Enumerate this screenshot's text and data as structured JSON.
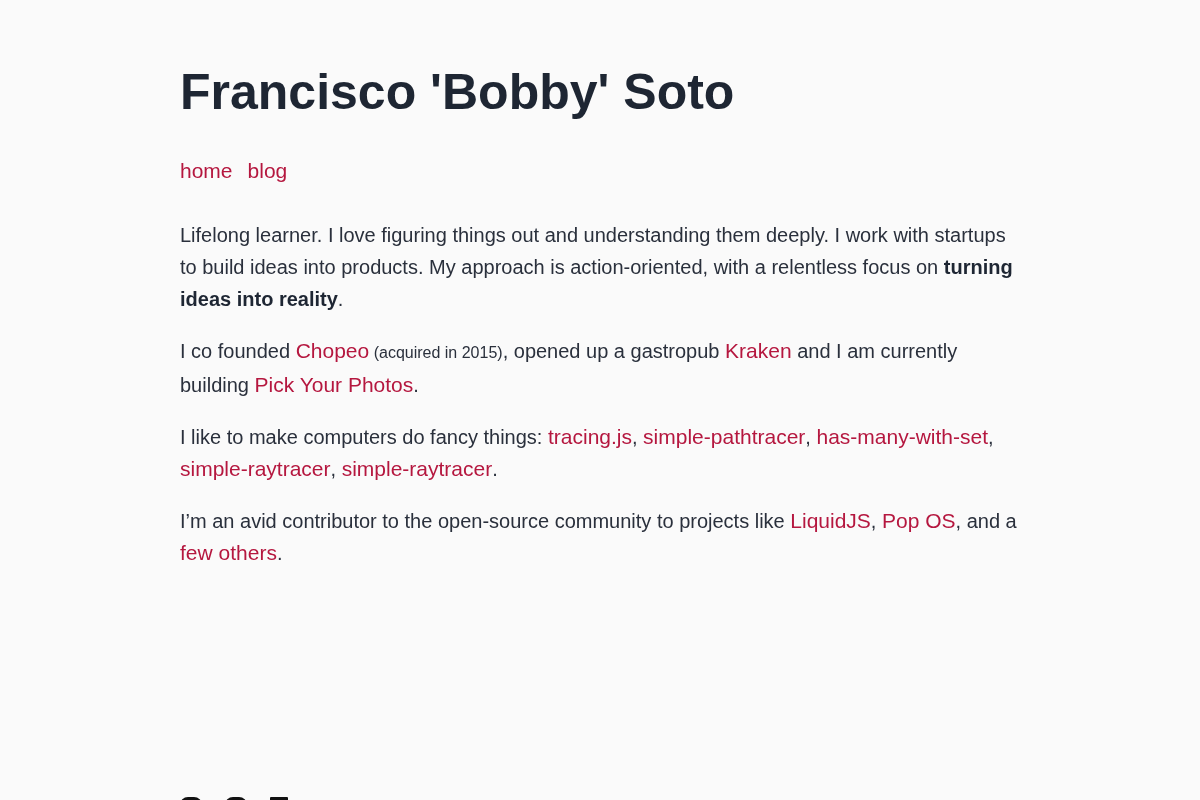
{
  "header": {
    "title": "Francisco 'Bobby' Soto"
  },
  "nav": [
    {
      "label": "home"
    },
    {
      "label": "blog"
    }
  ],
  "paragraphs": [
    [
      {
        "kind": "text",
        "text": "Lifelong learner. I love figuring things out and understanding them deeply. I work with startups to build ideas into products. My approach is action-oriented, with a relentless focus on **turning ideas into reality**."
      }
    ],
    [
      {
        "kind": "text",
        "text": "I co founded "
      },
      {
        "kind": "link",
        "text": "Chopeo"
      },
      {
        "kind": "note",
        "text": " (acquired in 2015)"
      },
      {
        "kind": "text",
        "text": ", opened up a gastropub "
      },
      {
        "kind": "link",
        "text": "Kraken"
      },
      {
        "kind": "text",
        "text": " and I am currently building "
      },
      {
        "kind": "link",
        "text": "Pick Your Photos"
      },
      {
        "kind": "text",
        "text": "."
      }
    ],
    [
      {
        "kind": "text",
        "text": "I like to make computers do fancy things: "
      },
      {
        "kind": "link",
        "text": "tracing.js"
      },
      {
        "kind": "text",
        "text": ", "
      },
      {
        "kind": "link",
        "text": "simple-pathtracer"
      },
      {
        "kind": "text",
        "text": ", "
      },
      {
        "kind": "link",
        "text": "has-many-with-set"
      },
      {
        "kind": "text",
        "text": ", "
      },
      {
        "kind": "link",
        "text": "simple-raytracer"
      },
      {
        "kind": "text",
        "text": ", "
      },
      {
        "kind": "link",
        "text": "simple-raytracer"
      },
      {
        "kind": "text",
        "text": "."
      }
    ],
    [
      {
        "kind": "text",
        "text": "I’m an avid contributor to the open-source community to projects like "
      },
      {
        "kind": "link",
        "text": "LiquidJS"
      },
      {
        "kind": "text",
        "text": ", "
      },
      {
        "kind": "link",
        "text": "Pop OS"
      },
      {
        "kind": "text",
        "text": ", and a "
      },
      {
        "kind": "link",
        "text": "few others"
      },
      {
        "kind": "text",
        "text": "."
      }
    ]
  ]
}
